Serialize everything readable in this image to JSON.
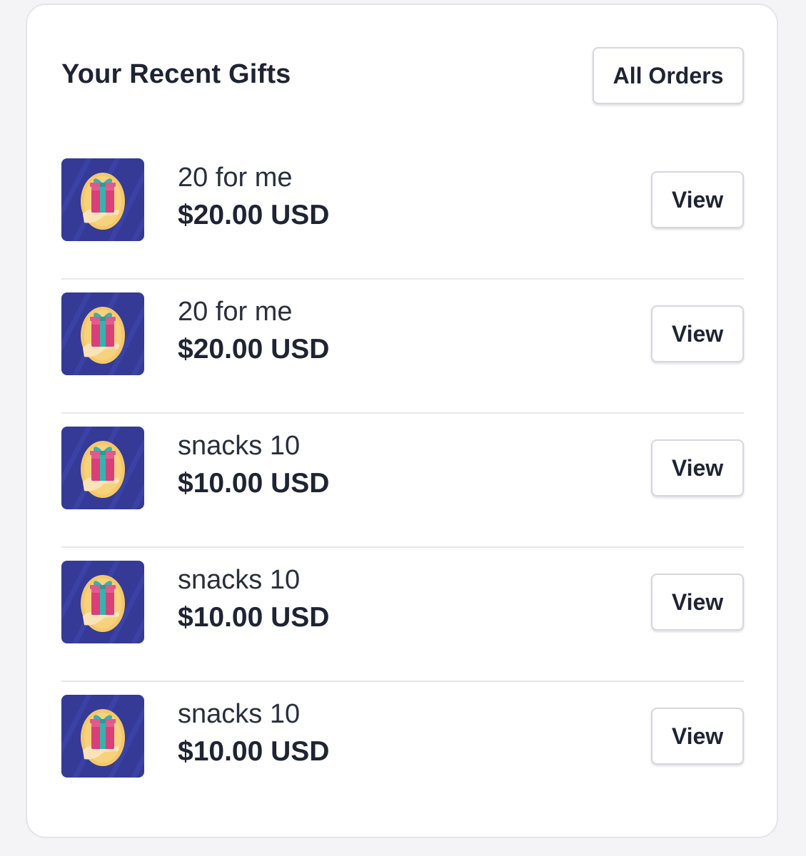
{
  "header": {
    "title": "Your Recent Gifts",
    "all_orders_label": "All Orders"
  },
  "gifts": [
    {
      "name": "20 for me",
      "price": "$20.00 USD",
      "view_label": "View",
      "icon": "gift-in-hand-icon"
    },
    {
      "name": "20 for me",
      "price": "$20.00 USD",
      "view_label": "View",
      "icon": "gift-in-hand-icon"
    },
    {
      "name": "snacks 10",
      "price": "$10.00 USD",
      "view_label": "View",
      "icon": "gift-in-hand-icon"
    },
    {
      "name": "snacks 10",
      "price": "$10.00 USD",
      "view_label": "View",
      "icon": "gift-in-hand-icon"
    },
    {
      "name": "snacks 10",
      "price": "$10.00 USD",
      "view_label": "View",
      "icon": "gift-in-hand-icon"
    }
  ],
  "colors": {
    "page_background": "#f4f4f6",
    "card_background": "#ffffff",
    "text_primary": "#1f2433",
    "thumb_background": "#343a96",
    "thumb_circle": "#f4c86a",
    "gift_box": "#d8407a",
    "gift_ribbon": "#38b2ac"
  }
}
